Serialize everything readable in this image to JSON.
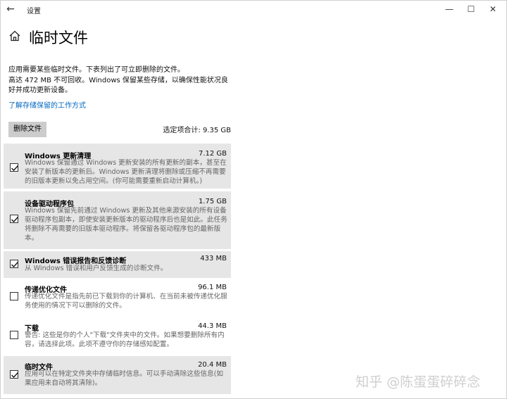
{
  "app_title": "设置",
  "page_title": "临时文件",
  "description_1": "应用需要某些临时文件。下表列出了可立即删除的文件。",
  "description_2": "高达 472 MB 不可回收。Windows 保留某些存储，以确保性能状况良好并成功更新设备。",
  "learn_link": "了解存储保留的工作方式",
  "delete_button": "删除文件",
  "selected_total": "选定项合计: 9.35 GB",
  "items": [
    {
      "name": "Windows 更新清理",
      "size": "7.12 GB",
      "checked": true,
      "description": "Windows 保留通过 Windows 更新安装的所有更新的副本，甚至在安装了新版本的更新后。Windows 更新清理将删除或压缩不再需要的旧版本更新以免占用空间。(你可能需要重新启动计算机。)"
    },
    {
      "name": "设备驱动程序包",
      "size": "1.75 GB",
      "checked": true,
      "description": "Windows 保留先前通过 Windows 更新及其他来源安装的所有设备驱动程序包副本，即使安装更新版本的驱动程序后也是如此。此任务将删除不再需要的旧版本驱动程序。将保留各驱动程序包的最新版本。"
    },
    {
      "name": "Windows 错误报告和反馈诊断",
      "size": "433 MB",
      "checked": true,
      "description": "从 Windows 错误和用户反馈生成的诊断文件。"
    },
    {
      "name": "传递优化文件",
      "size": "96.1 MB",
      "checked": false,
      "description": "传递优化文件是指先前已下载到你的计算机、在当前未被传递优化服务使用的情况下可以删除的文件。"
    },
    {
      "name": "下载",
      "size": "44.3 MB",
      "checked": false,
      "description": "警告: 这些是你的个人\"下载\"文件夹中的文件。如果想要删除所有内容，请选择此项。此项不遵守你的存储感知配置。"
    },
    {
      "name": "临时文件",
      "size": "20.4 MB",
      "checked": true,
      "description": "应用可以在特定文件夹中存储临时信息。可以手动清除这些信息(如果应用未自动将其清除)。"
    }
  ],
  "watermark": "知乎 @陈蛋蛋碎碎念",
  "accent_color": "#0067c0"
}
